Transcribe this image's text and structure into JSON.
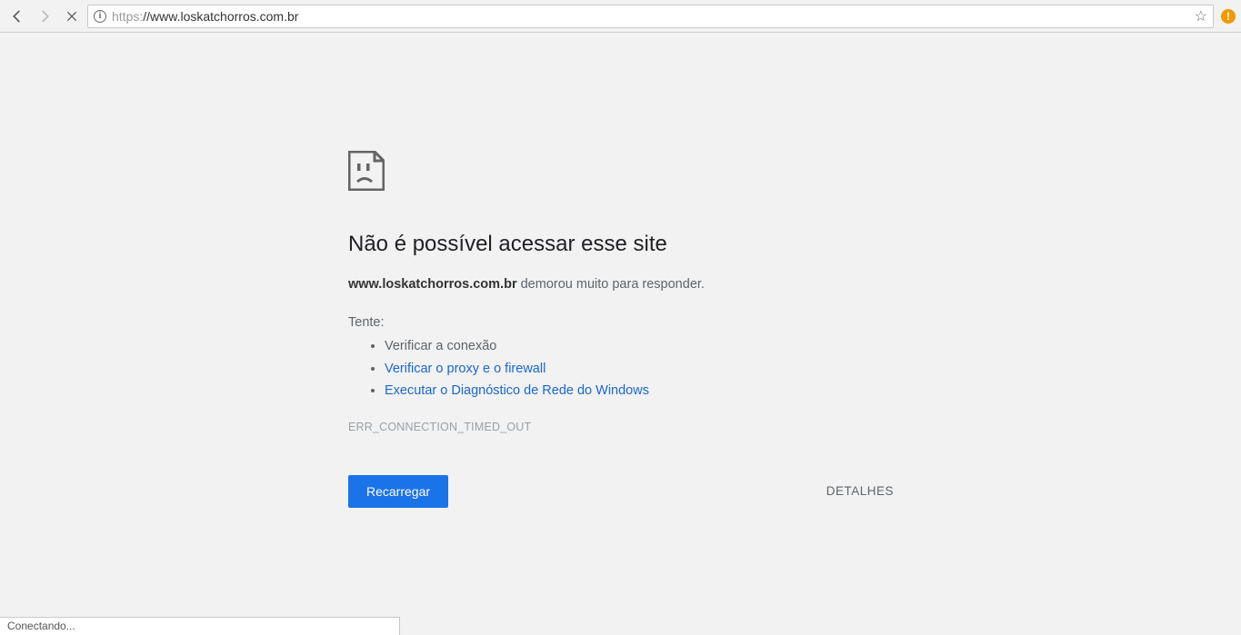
{
  "toolbar": {
    "url_prefix": "https:",
    "url_main": "//www.loskatchorros.com.br"
  },
  "error": {
    "headline": "Não é possível acessar esse site",
    "host_bold": "www.loskatchorros.com.br",
    "host_rest": " demorou muito para responder.",
    "try_label": "Tente:",
    "suggestions": [
      {
        "text": "Verificar a conexão",
        "link": false
      },
      {
        "text": "Verificar o proxy e o firewall",
        "link": true
      },
      {
        "text": "Executar o Diagnóstico de Rede do Windows",
        "link": true
      }
    ],
    "code": "ERR_CONNECTION_TIMED_OUT",
    "reload_label": "Recarregar",
    "details_label": "DETALHES"
  },
  "status": "Conectando..."
}
